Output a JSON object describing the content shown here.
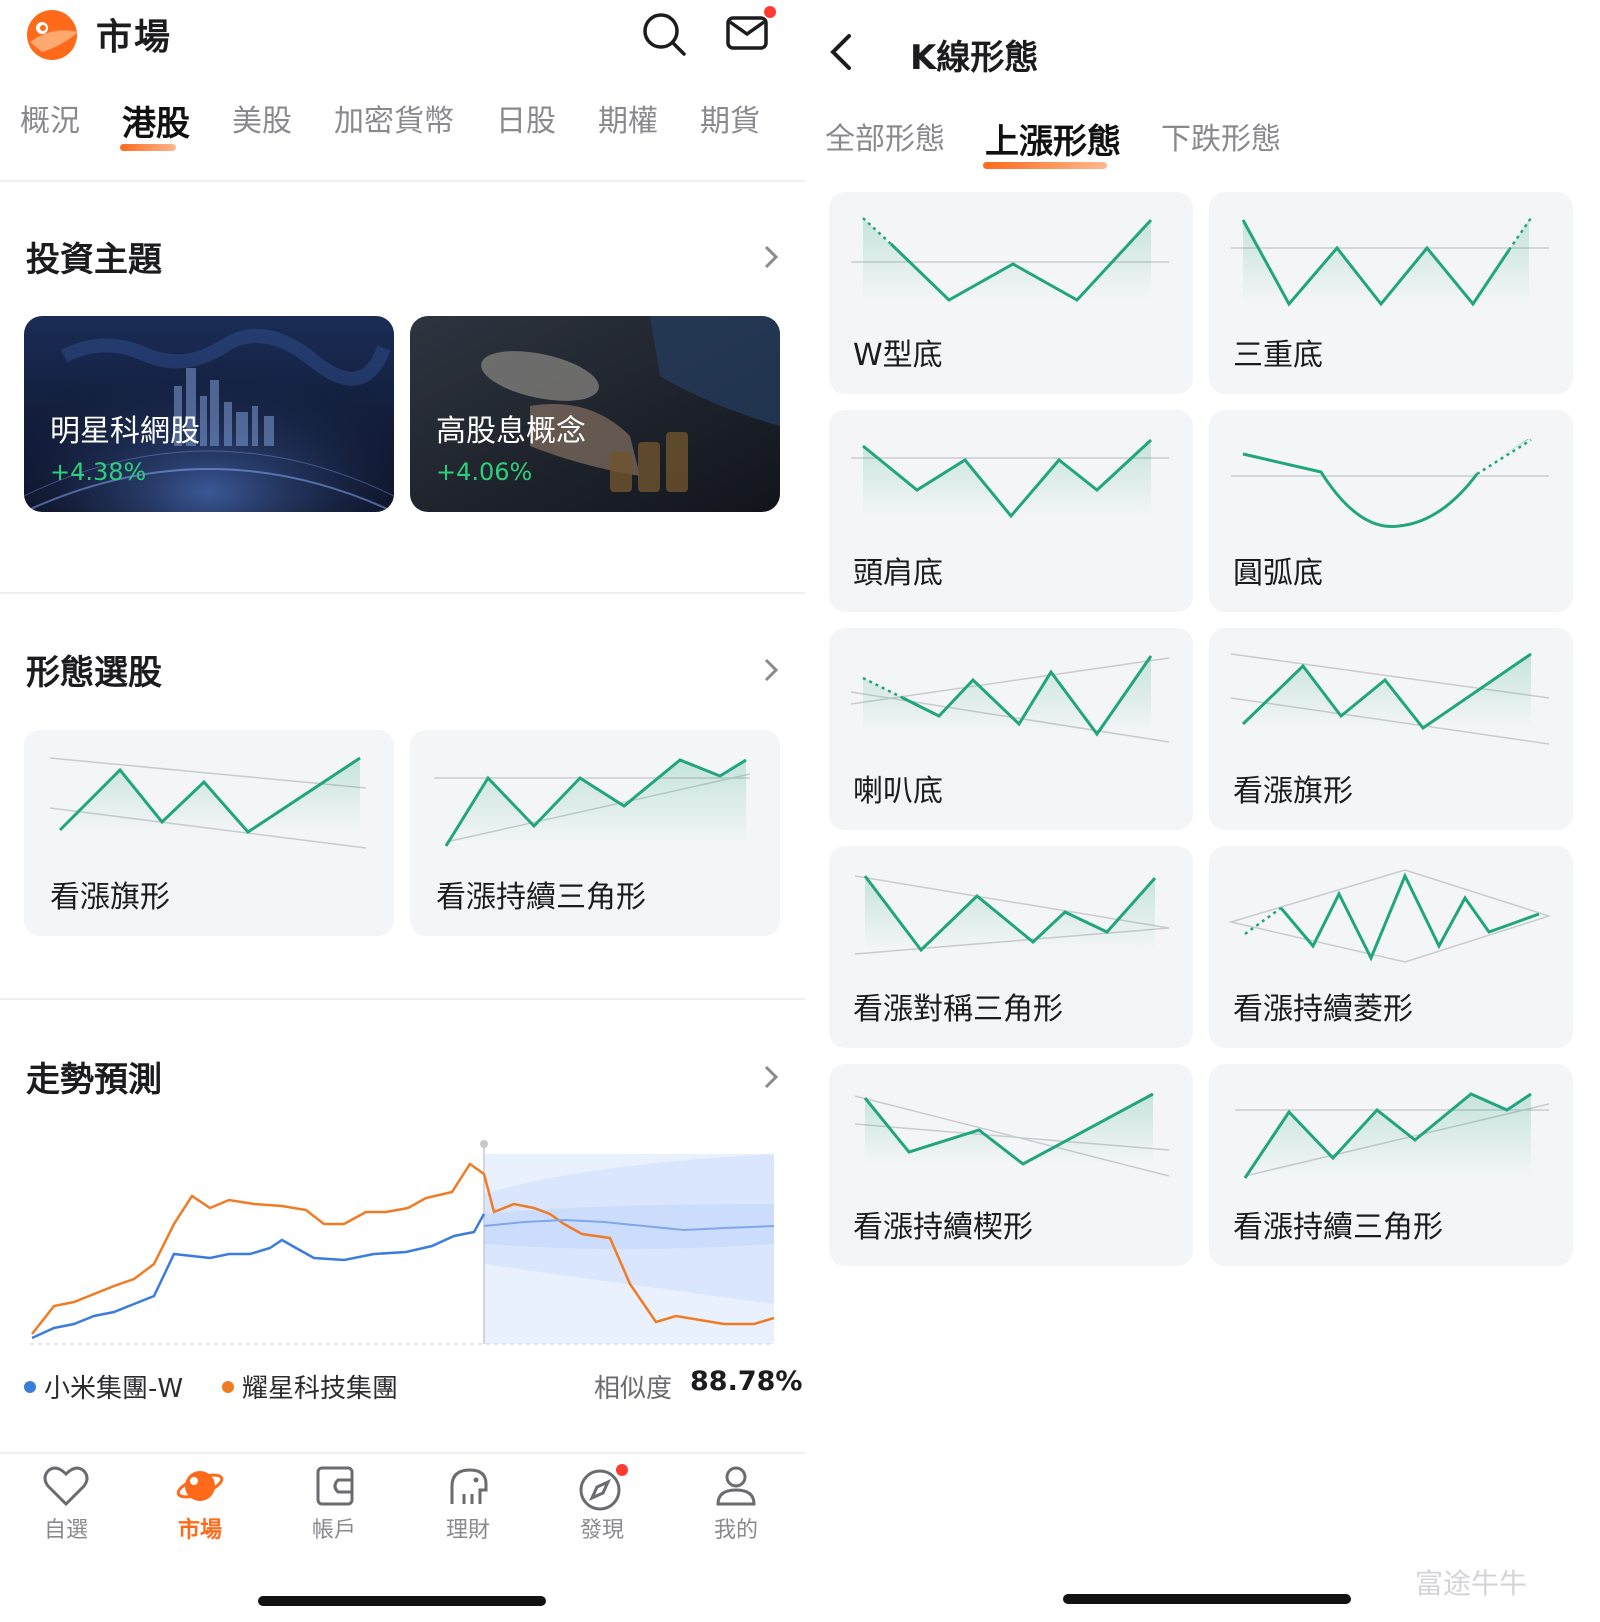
{
  "left": {
    "app_title": "市場",
    "tabs": [
      "概況",
      "港股",
      "美股",
      "加密貨幣",
      "日股",
      "期權",
      "期貨"
    ],
    "active_tab": "港股",
    "sections": {
      "themes": {
        "title": "投資主題",
        "cards": [
          {
            "name": "明星科網股",
            "change": "+4.38%"
          },
          {
            "name": "高股息概念",
            "change": "+4.06%"
          }
        ]
      },
      "patterns": {
        "title": "形態選股",
        "cards": [
          {
            "name": "看漲旗形"
          },
          {
            "name": "看漲持續三角形"
          }
        ]
      },
      "trend": {
        "title": "走勢預測",
        "legend": [
          {
            "name": "小米集團-W",
            "color": "#3b7ddd"
          },
          {
            "name": "耀星科技集團",
            "color": "#f07b22"
          }
        ],
        "similarity_label": "相似度",
        "similarity_value": "88.78%"
      }
    },
    "nav": [
      {
        "label": "自選",
        "icon": "heart-icon"
      },
      {
        "label": "市場",
        "icon": "planet-icon",
        "active": true
      },
      {
        "label": "帳戶",
        "icon": "wallet-icon"
      },
      {
        "label": "理財",
        "icon": "piggy-bank-icon"
      },
      {
        "label": "發現",
        "icon": "compass-icon"
      },
      {
        "label": "我的",
        "icon": "user-icon"
      }
    ]
  },
  "right": {
    "title": "K線形態",
    "tabs": [
      "全部形態",
      "上漲形態",
      "下跌形態"
    ],
    "active_tab": "上漲形態",
    "patterns": [
      {
        "name": "W型底"
      },
      {
        "name": "三重底"
      },
      {
        "name": "頭肩底"
      },
      {
        "name": "圓弧底"
      },
      {
        "name": "喇叭底"
      },
      {
        "name": "看漲旗形"
      },
      {
        "name": "看漲對稱三角形"
      },
      {
        "name": "看漲持續菱形"
      },
      {
        "name": "看漲持續楔形"
      },
      {
        "name": "看漲持續三角形"
      }
    ],
    "watermark": "富途牛牛"
  },
  "colors": {
    "accent": "#ff6a1a",
    "green": "#21a67a",
    "positive": "#2dcf7c",
    "series_blue": "#3b7ddd",
    "series_orange": "#f07b22"
  }
}
